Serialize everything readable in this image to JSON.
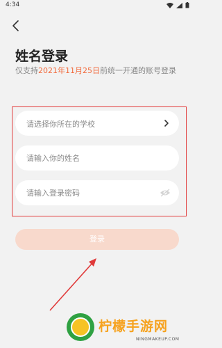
{
  "status_bar": {
    "time": "4:34"
  },
  "page": {
    "title": "姓名登录",
    "subtitle_prefix": "仅支持",
    "subtitle_date": "2021年11月25日",
    "subtitle_suffix": "前统一开通的账号登录"
  },
  "form": {
    "school_placeholder": "请选择你所在的学校",
    "name_placeholder": "请输入你的姓名",
    "password_placeholder": "请输入登录密码"
  },
  "login_button": {
    "label": "登录"
  },
  "colors": {
    "accent": "#f26a3c",
    "button_disabled": "#f8d9cc",
    "highlight_box": "#e23b3b"
  },
  "watermark": {
    "name": "柠檬手游网",
    "url": "NINGMAKEUP.COM"
  }
}
